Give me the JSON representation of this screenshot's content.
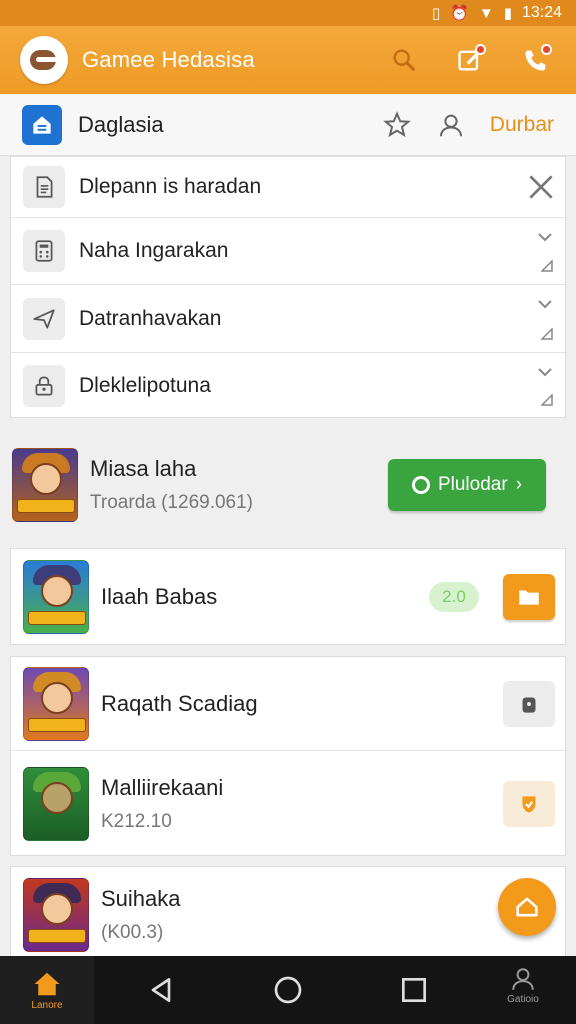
{
  "status_bar": {
    "time": "13:24"
  },
  "app_bar": {
    "title": "Gamee Hedasisa",
    "actions": [
      "search-icon",
      "edit-icon",
      "phone-icon"
    ]
  },
  "sub_bar": {
    "title": "Daglasia",
    "link": "Durbar"
  },
  "menu": [
    {
      "label": "Dlepann is haradan",
      "icon": "document-icon",
      "trailing": "close"
    },
    {
      "label": "Naha Ingarakan",
      "icon": "calculator-icon",
      "trailing": "expand"
    },
    {
      "label": "Datranhavakan",
      "icon": "send-icon",
      "trailing": "expand"
    },
    {
      "label": "Dleklelipotuna",
      "icon": "lock-icon",
      "trailing": "expand"
    }
  ],
  "games": [
    {
      "name": "Miasa laha",
      "meta": "Troarda (1269.061)",
      "action_label": "Plulodar",
      "action_type": "play"
    },
    {
      "name": "Ilaah Babas",
      "meta": "",
      "badge": "2.0",
      "action_type": "orange"
    },
    {
      "name": "Raqath Scadiag",
      "meta": "",
      "action_type": "grey"
    },
    {
      "name": "Malliirekaani",
      "meta": "K212.10",
      "action_type": "cream"
    },
    {
      "name": "Suihaka",
      "meta": "(K00.3)",
      "action_type": "fab"
    }
  ],
  "nav": {
    "home_label": "Lanore",
    "profile_label": "Gatioio"
  },
  "colors": {
    "accent": "#ee9a26",
    "status": "#e08a1e",
    "play": "#3aa43f",
    "primary_blue": "#1e72d1"
  }
}
